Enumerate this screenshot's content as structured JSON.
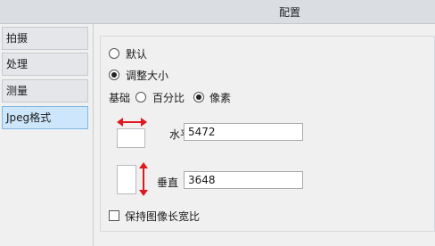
{
  "window": {
    "title": "配置"
  },
  "sidebar": {
    "items": [
      {
        "label": "拍摄",
        "active": false
      },
      {
        "label": "处理",
        "active": false
      },
      {
        "label": "测量",
        "active": false
      },
      {
        "label": "Jpeg格式",
        "active": true
      }
    ]
  },
  "options": {
    "default_label": "默认",
    "default_checked": false,
    "resize_label": "调整大小",
    "resize_checked": true,
    "basis_label": "基础",
    "percent_label": "百分比",
    "percent_checked": false,
    "pixel_label": "像素",
    "pixel_checked": true
  },
  "size": {
    "horizontal_label": "水平",
    "horizontal_value": "5472",
    "vertical_label": "垂直",
    "vertical_value": "3648"
  },
  "keep_ratio": {
    "label": "保持图像长宽比",
    "checked": false
  },
  "colors": {
    "arrow_red": "#e0181f",
    "active_tab": "#cde6fb"
  }
}
